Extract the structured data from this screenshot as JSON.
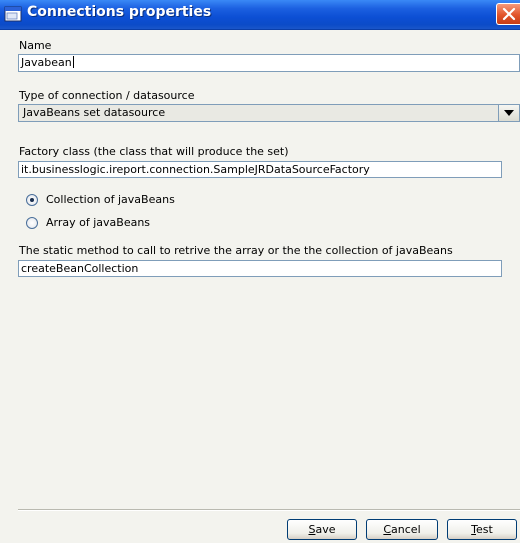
{
  "window": {
    "title": "Connections properties",
    "icon": "dialog-window-icon",
    "close_icon": "close-icon"
  },
  "name": {
    "label": "Name",
    "value": "Javabean"
  },
  "type": {
    "label": "Type of connection / datasource",
    "selected": "JavaBeans set datasource"
  },
  "factory": {
    "label": "Factory class (the class that will produce the set)",
    "value": "it.businesslogic.ireport.connection.SampleJRDataSourceFactory"
  },
  "radio": {
    "collection": {
      "label": "Collection of javaBeans",
      "checked": true
    },
    "array": {
      "label": "Array of javaBeans",
      "checked": false
    }
  },
  "method": {
    "label": "The static method to call to retrive the array or the the collection of javaBeans",
    "value": "createBeanCollection"
  },
  "buttons": {
    "save": {
      "mnemonic": "S",
      "rest": "ave"
    },
    "cancel": {
      "mnemonic": "C",
      "rest": "ancel"
    },
    "test": {
      "mnemonic": "T",
      "rest": "est"
    }
  },
  "colors": {
    "titlebar": "#0c4fd4",
    "window_bg": "#f3f3ee",
    "field_border": "#7f9db9",
    "close_button": "#e2542a"
  }
}
